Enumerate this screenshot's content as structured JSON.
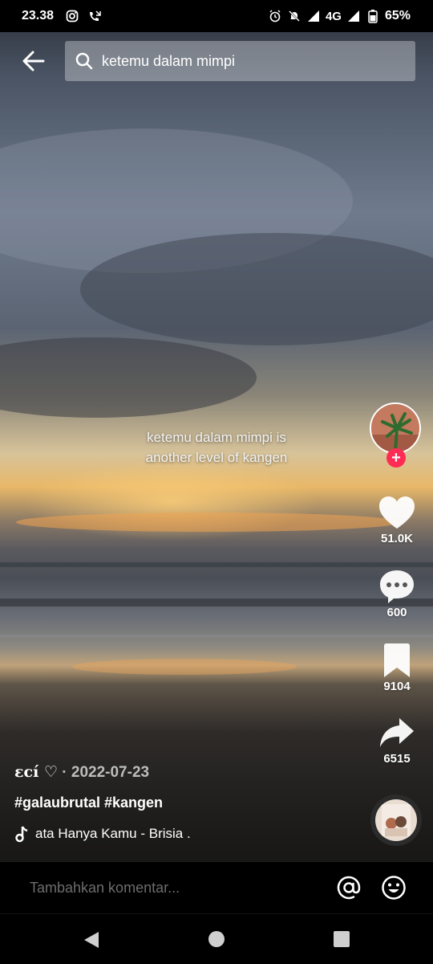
{
  "status_bar": {
    "time": "23.38",
    "network": "4G",
    "battery": "65%"
  },
  "search": {
    "query": "ketemu dalam mimpi"
  },
  "video": {
    "caption_line1": "ketemu dalam mimpi is",
    "caption_line2": "another level of kangen"
  },
  "actions": {
    "likes": "51.0K",
    "comments": "600",
    "bookmarks": "9104",
    "shares": "6515"
  },
  "post": {
    "username": "εcí ♡",
    "separator": " · ",
    "date": "2022-07-23",
    "hashtags": "#galaubrutal #kangen",
    "music": "ata Hanya Kamu - Brisia ."
  },
  "comment_bar": {
    "placeholder": "Tambahkan komentar..."
  },
  "colors": {
    "accent": "#fe2c55",
    "sky_top": "#4f5a6a",
    "sunset": "#e9b56a"
  },
  "icons": [
    "instagram-icon",
    "missed-call-icon",
    "alarm-icon",
    "mute-icon",
    "signal-icon",
    "wifi-icon",
    "battery-icon",
    "back-arrow-icon",
    "search-icon",
    "heart-icon",
    "comment-icon",
    "bookmark-icon",
    "share-icon",
    "music-note-icon",
    "at-icon",
    "emoji-icon",
    "nav-back-icon",
    "nav-home-icon",
    "nav-recents-icon"
  ]
}
